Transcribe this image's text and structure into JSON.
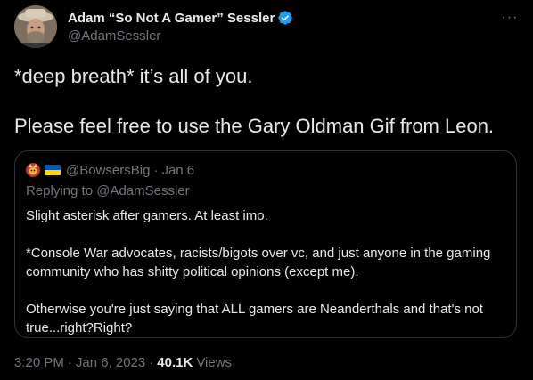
{
  "author": {
    "display_name": "Adam “So Not A Gamer” Sessler",
    "handle": "@AdamSessler",
    "verified_color": "#1d9bf0"
  },
  "more_label": "···",
  "tweet": {
    "lines": [
      "*deep breath* it’s all of you.",
      "Please feel free to use the Gary Oldman Gif from Leon."
    ]
  },
  "quote": {
    "handle": "@BowsersBig",
    "separator": "·",
    "date": "Jan 6",
    "flag_colors": [
      "#0057b7",
      "#ffd700"
    ],
    "replying_to": "Replying to @AdamSessler",
    "paragraphs": [
      "Slight asterisk after gamers. At least imo.",
      "*Console War advocates, racists/bigots over vc, and just anyone in the gaming community who has shitty political opinions (except me).",
      "Otherwise you're just saying that ALL gamers are Neanderthals and that's not true...right?Right?"
    ]
  },
  "meta": {
    "time": "3:20 PM",
    "separator": "·",
    "date": "Jan 6, 2023",
    "views_count": "40.1K",
    "views_label": "Views"
  }
}
